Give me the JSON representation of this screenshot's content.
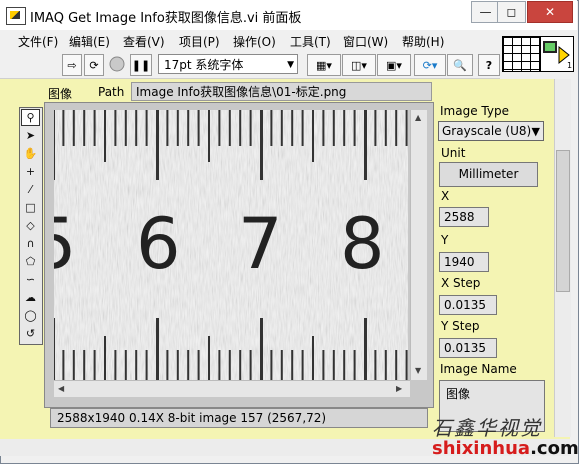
{
  "window": {
    "title": "IMAQ Get Image Info获取图像信息.vi 前面板",
    "minimize_icon": "minimize-icon",
    "maximize_icon": "maximize-icon",
    "close_icon": "close-icon"
  },
  "menu": {
    "items": [
      "文件(F)",
      "编辑(E)",
      "查看(V)",
      "项目(P)",
      "操作(O)",
      "工具(T)",
      "窗口(W)",
      "帮助(H)"
    ]
  },
  "toolbar": {
    "font_selector": "17pt 系统字体",
    "buttons": [
      "run-arrow-icon",
      "run-continuous-icon",
      "abort-icon",
      "pause-icon",
      "align-icon",
      "distribute-icon",
      "resize-icon",
      "reorder-icon",
      "search-icon",
      "help-icon"
    ]
  },
  "panel": {
    "tab_image": "图像",
    "tab_path": "Path",
    "path_value": "Image Info获取图像信息\\01-标定.png",
    "status_text": "2588x1940 0.14X 8-bit image 157     (2567,72)",
    "ruler_digits": [
      "5",
      "6",
      "7",
      "8"
    ]
  },
  "controls": {
    "image_type_label": "Image Type",
    "image_type_value": "Grayscale (U8)",
    "unit_label": "Unit",
    "unit_value": "Millimeter",
    "x_label": "X",
    "x_value": "2588",
    "y_label": "Y",
    "y_value": "1940",
    "x_step_label": "X Step",
    "x_step_value": "0.0135",
    "y_step_label": "Y Step",
    "y_step_value": "0.0135",
    "image_name_label": "Image Name",
    "image_name_value": "图像"
  },
  "watermark": {
    "chinese": "石鑫华视觉",
    "url_red": "shixinhua",
    "url_black": ".com"
  }
}
